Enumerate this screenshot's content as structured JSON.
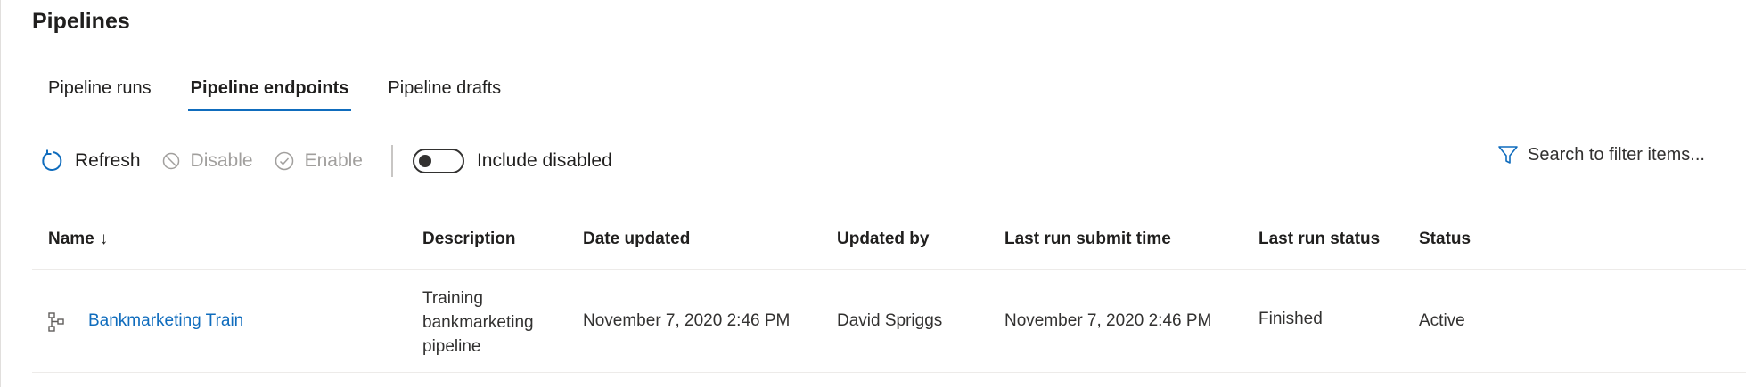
{
  "page": {
    "title": "Pipelines"
  },
  "tabs": [
    {
      "label": "Pipeline runs"
    },
    {
      "label": "Pipeline endpoints",
      "active": true
    },
    {
      "label": "Pipeline drafts"
    }
  ],
  "toolbar": {
    "refresh_label": "Refresh",
    "disable_label": "Disable",
    "enable_label": "Enable",
    "include_disabled_label": "Include disabled",
    "include_disabled_on": false
  },
  "search": {
    "placeholder": "Search to filter items..."
  },
  "table": {
    "columns": {
      "name": "Name",
      "description": "Description",
      "date_updated": "Date updated",
      "updated_by": "Updated by",
      "last_run_submit_time": "Last run submit time",
      "last_run_status": "Last run status",
      "status": "Status"
    },
    "sort": {
      "column": "Name",
      "direction": "descending"
    },
    "rows": [
      {
        "name": "Bankmarketing Train",
        "description": "Training bankmarketing pipeline",
        "date_updated": "November 7, 2020 2:46 PM",
        "updated_by": "David Spriggs",
        "last_run_submit_time": "November 7, 2020 2:46 PM",
        "last_run_status": "Finished",
        "status": "Active"
      }
    ]
  },
  "icons": {
    "refresh": "refresh-icon",
    "disable": "block-icon",
    "enable": "check-circle-icon",
    "filter": "filter-icon",
    "pipeline": "pipeline-icon",
    "sort": "arrow-down-icon"
  },
  "colors": {
    "accent": "#0f6cbd",
    "disabled_text": "#a19f9d",
    "text": "#201f1e"
  }
}
